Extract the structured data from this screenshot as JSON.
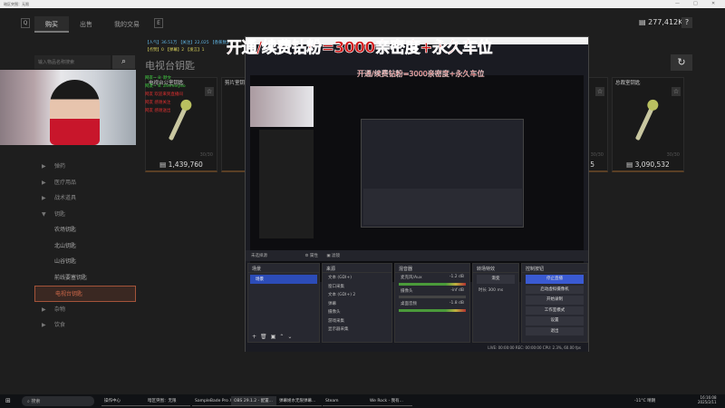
{
  "window": {
    "title": "暗区突围：无限"
  },
  "game": {
    "key_q": "Q",
    "key_e": "E",
    "tabs": [
      {
        "label": "购买",
        "active": true
      },
      {
        "label": "出售"
      },
      {
        "label": "我的交易"
      }
    ],
    "currency": "277,412K",
    "help": "?",
    "search_placeholder": "输入物品名称搜索",
    "category_title": "电视台钥匙",
    "categories": [
      {
        "label": "弹药"
      },
      {
        "label": "医疗用品"
      },
      {
        "label": "战术道具"
      },
      {
        "label": "钥匙",
        "expanded": true
      },
      {
        "label": "农场钥匙",
        "sub": true
      },
      {
        "label": "北山钥匙",
        "sub": true
      },
      {
        "label": "山谷钥匙",
        "sub": true
      },
      {
        "label": "前线要塞钥匙",
        "sub": true
      },
      {
        "label": "电视台钥匙",
        "sub": true,
        "selected": true
      },
      {
        "label": "杂物"
      },
      {
        "label": "饮食"
      }
    ],
    "cards": [
      {
        "name": "电视台公室钥匙",
        "stock": "30/30",
        "price": "1,439,760"
      },
      {
        "name": "剪片室钥",
        "stock": "30/30",
        "price": "5"
      },
      {
        "name": "总裁室钥匙",
        "stock": "30/30",
        "price": "3,090,532"
      }
    ],
    "accent": "#d26a4a"
  },
  "stream_overlay": {
    "banner": "开通/续费钻粉=3000亲密度+永久车位",
    "stats_line1": "【人气】36.51万 【关注】22,025 【香蕉数】4",
    "stats_line2": "【点赞】0 【弹幕】2 【发言】1",
    "chat": [
      "网友~ 8: 默文",
      "网友~ 8: zhemeiyao",
      "网友 欢迎来到直播间",
      "网友 感谢关注",
      "网友 感谢送出"
    ]
  },
  "obs": {
    "nested_banner": "开通/续费钻粉=3000亲密度+永久车位",
    "toolbar": {
      "no_source": "未选择源",
      "properties": "属性",
      "filters": "滤镜"
    },
    "scenes": {
      "title": "场景",
      "items": [
        "场景"
      ]
    },
    "sources": {
      "title": "来源",
      "items": [
        "文本 (GDI+)",
        "窗口采集",
        "文本 (GDI+) 2",
        "弹幕",
        "摄像头",
        "游戏采集",
        "显示器采集"
      ]
    },
    "mixer": {
      "title": "混音器",
      "channels": [
        {
          "name": "麦克风/Aux",
          "db": "-1.2 dB"
        },
        {
          "name": "摄像头",
          "db": "-inf dB"
        },
        {
          "name": "桌面音频",
          "db": "-1.8 dB"
        }
      ]
    },
    "transitions": {
      "title": "转场特效",
      "type": "渐变",
      "duration_label": "时长",
      "duration": "300 ms"
    },
    "controls": {
      "title": "控制按钮",
      "buttons": [
        "停止直播",
        "启动虚拟摄像机",
        "开始录制",
        "工作室模式",
        "设置",
        "退出"
      ]
    },
    "status": "LIVE: 00:00:00   REC: 00:00:00   CPU: 2.3%, 60.00 fps"
  },
  "taskbar": {
    "search": "搜索",
    "apps": [
      "操作中心",
      "暗区突围：无限",
      "SampleBade Pro X...",
      "OBS 29.1.2 - 配置...",
      "弹幕姬水无限弹幕...",
      "Steam",
      "We Rock - 我有..."
    ],
    "weather": "-11°C 晴朗",
    "time": "16:16:08",
    "date": "2025/2/11"
  }
}
